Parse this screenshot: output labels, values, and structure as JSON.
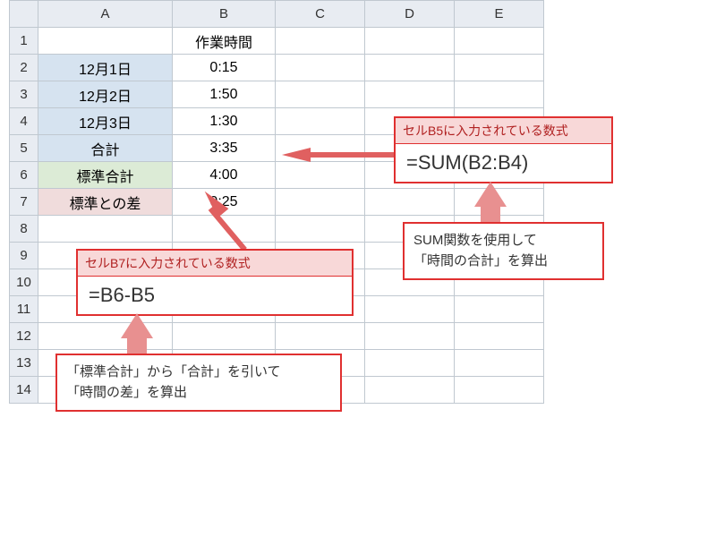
{
  "cols": [
    "A",
    "B",
    "C",
    "D",
    "E"
  ],
  "rows": [
    "1",
    "2",
    "3",
    "4",
    "5",
    "6",
    "7",
    "8",
    "9",
    "10",
    "11",
    "12",
    "13",
    "14"
  ],
  "cells": {
    "B1": "作業時間",
    "A2": "12月1日",
    "B2": "0:15",
    "A3": "12月2日",
    "B3": "1:50",
    "A4": "12月3日",
    "B4": "1:30",
    "A5": "合計",
    "B5": "3:35",
    "A6": "標準合計",
    "B6": "4:00",
    "A7": "標準との差",
    "B7": "0:25"
  },
  "callout_b5": {
    "header": "セルB5に入力されている数式",
    "formula": "=SUM(B2:B4)",
    "note_l1": "SUM関数を使用して",
    "note_l2": "「時間の合計」を算出"
  },
  "callout_b7": {
    "header": "セルB7に入力されている数式",
    "formula": "=B6-B5",
    "note_l1": "「標準合計」から「合計」を引いて",
    "note_l2": "「時間の差」を算出"
  }
}
